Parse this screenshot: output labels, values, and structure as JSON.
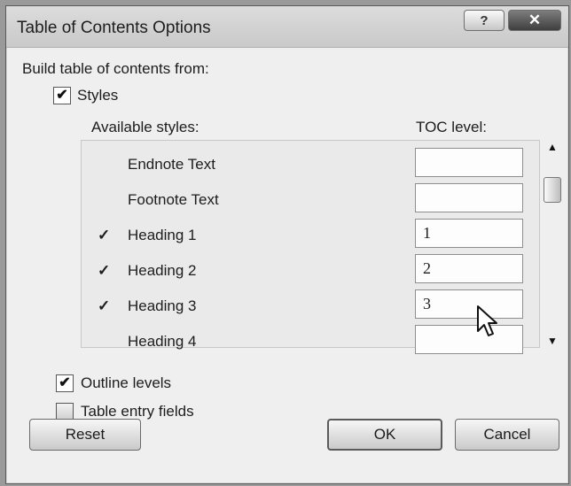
{
  "dialog": {
    "title": "Table of Contents Options",
    "help_label": "?",
    "close_label": "✕"
  },
  "build_from_label": "Build table of contents from:",
  "styles_checkbox": {
    "label": "Styles",
    "checked": true
  },
  "columns": {
    "available": "Available styles:",
    "toc_level": "TOC level:"
  },
  "styles": [
    {
      "name": "Endnote Text",
      "checked": false,
      "level": ""
    },
    {
      "name": "Footnote Text",
      "checked": false,
      "level": ""
    },
    {
      "name": "Heading 1",
      "checked": true,
      "level": "1"
    },
    {
      "name": "Heading 2",
      "checked": true,
      "level": "2"
    },
    {
      "name": "Heading 3",
      "checked": true,
      "level": "3"
    },
    {
      "name": "Heading 4",
      "checked": false,
      "level": ""
    }
  ],
  "outline_levels": {
    "label": "Outline levels",
    "checked": true
  },
  "table_entry_fields": {
    "label": "Table entry fields",
    "checked": false
  },
  "buttons": {
    "reset": "Reset",
    "ok": "OK",
    "cancel": "Cancel"
  },
  "check_mark": "✔",
  "row_check_mark": "✓"
}
